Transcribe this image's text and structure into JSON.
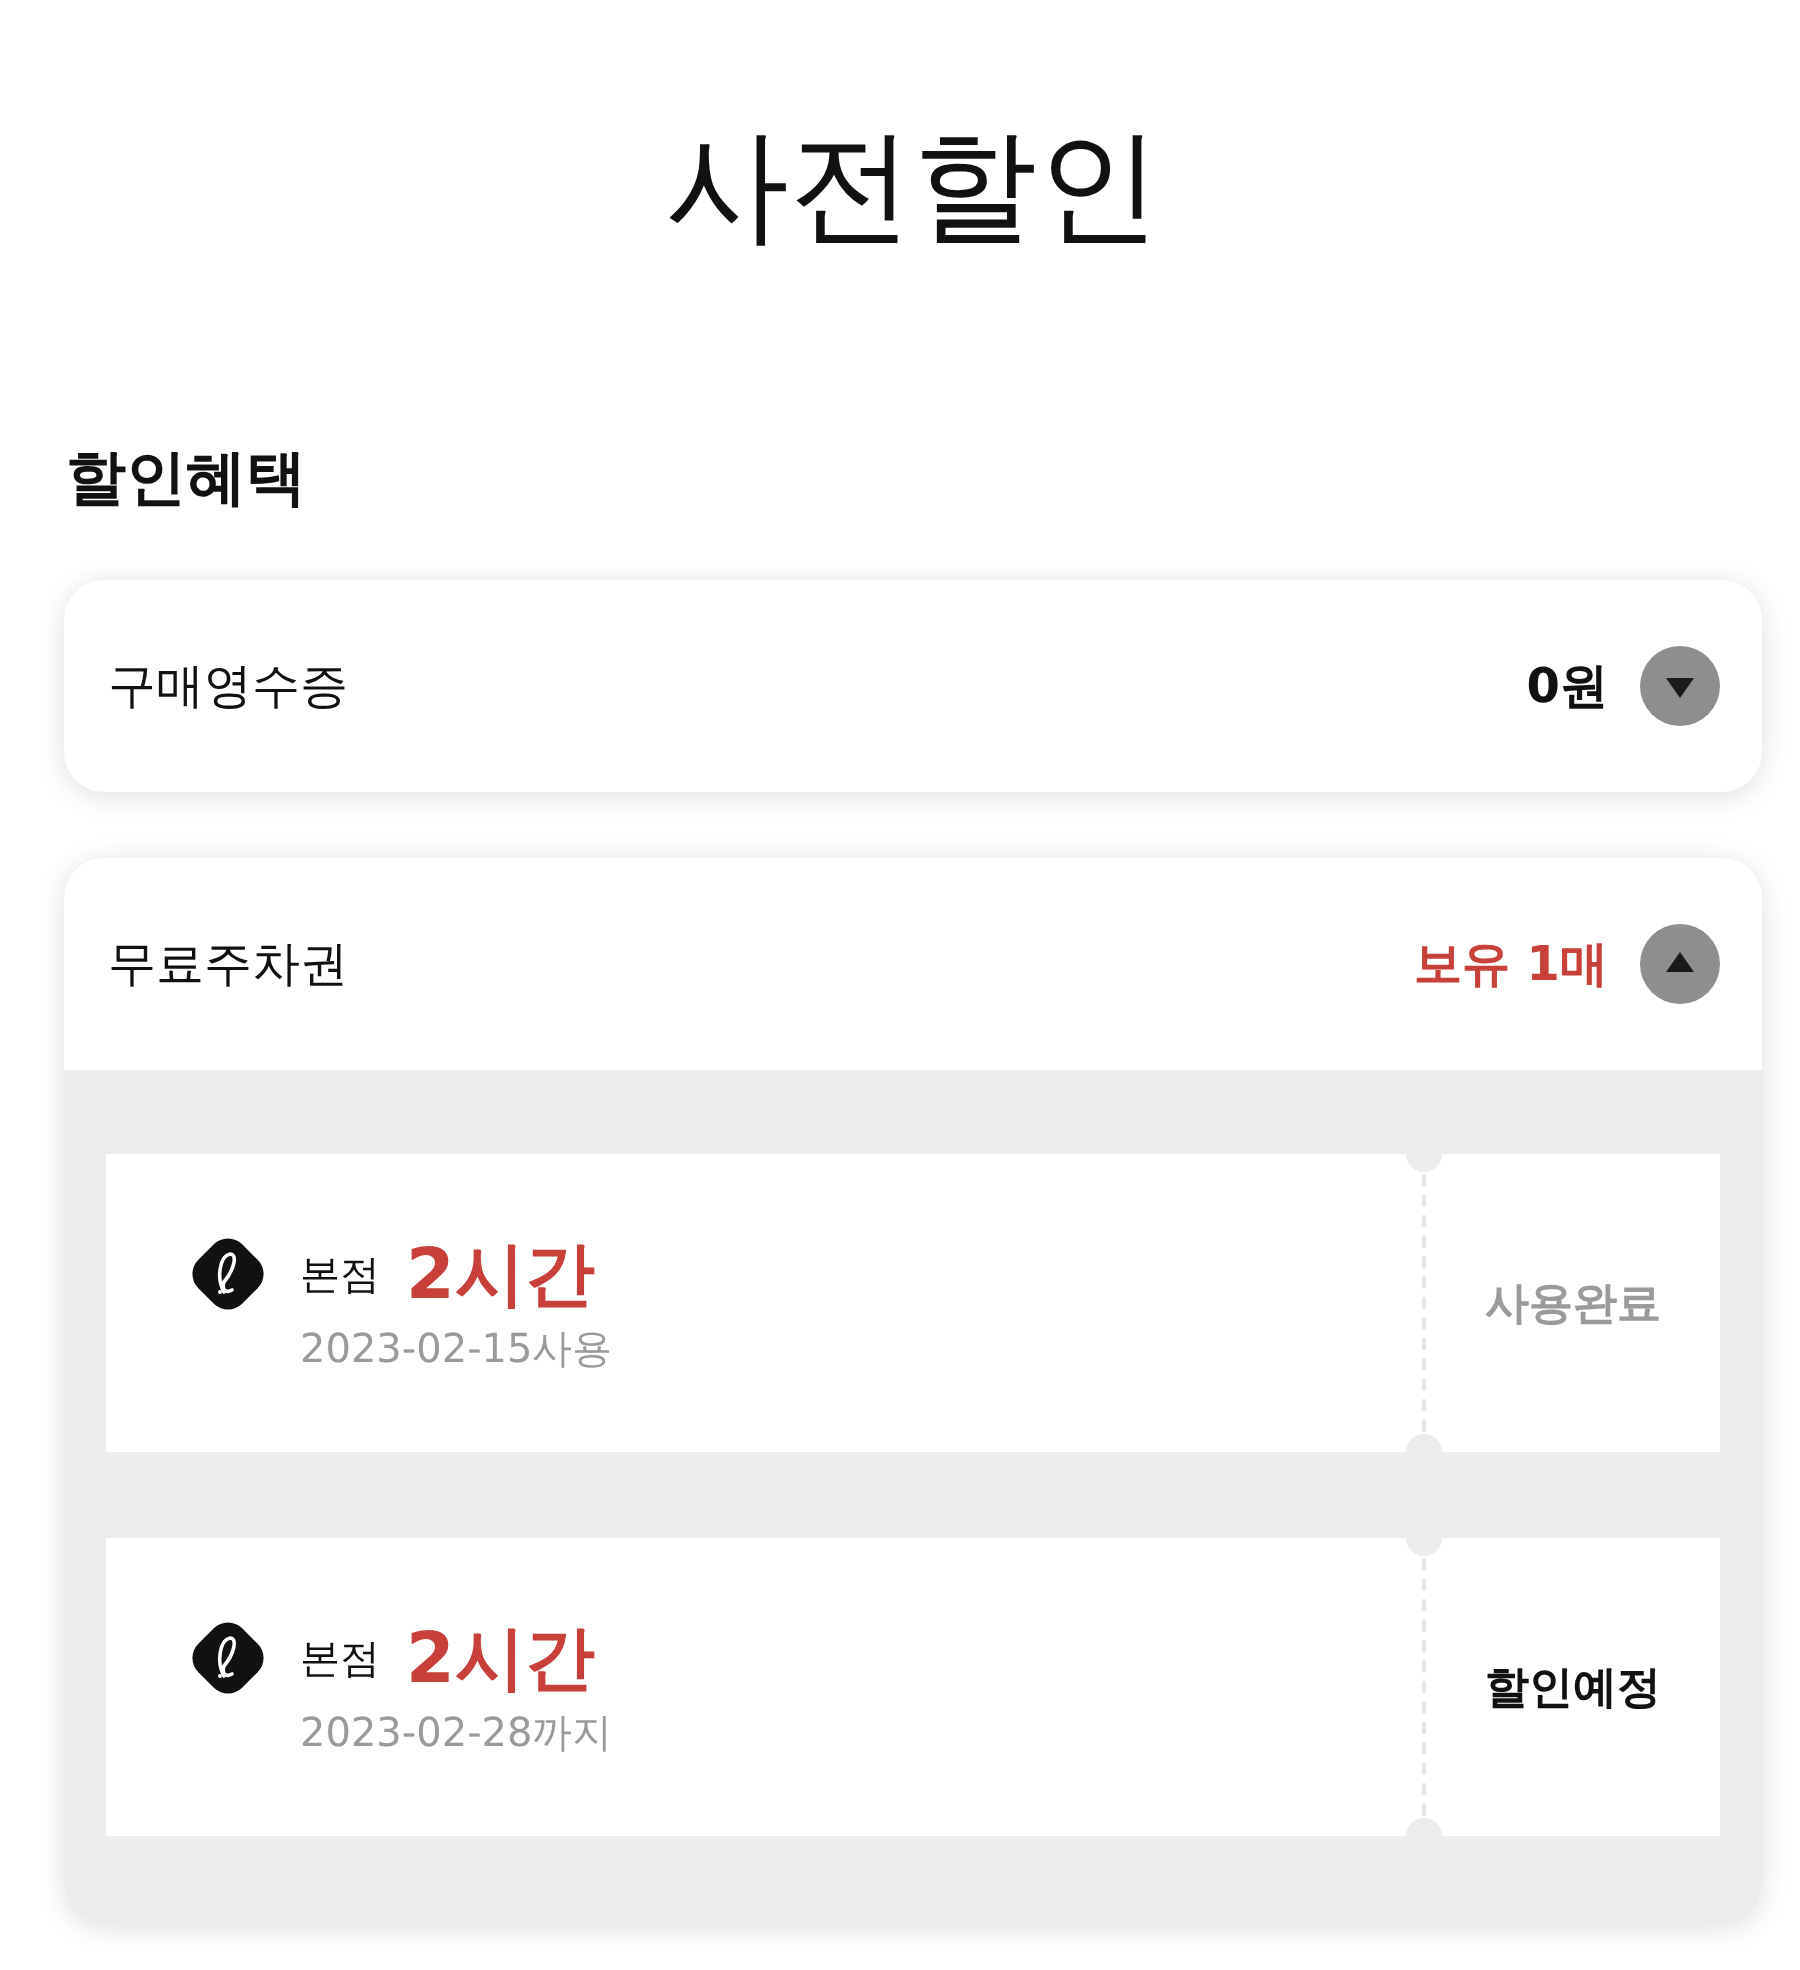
{
  "page": {
    "title": "사전할인"
  },
  "section": {
    "heading": "할인혜택"
  },
  "benefits": [
    {
      "label": "구매영수증",
      "value": "0원",
      "highlighted": false,
      "expanded": false
    },
    {
      "label": "무료주차권",
      "value": "보유 1매",
      "highlighted": true,
      "expanded": true,
      "coupons": [
        {
          "branch": "본점",
          "duration": "2시간",
          "date": "2023-02-15사용",
          "status": "사용완료",
          "used": true
        },
        {
          "branch": "본점",
          "duration": "2시간",
          "date": "2023-02-28까지",
          "status": "할인예정",
          "used": false
        }
      ]
    }
  ]
}
